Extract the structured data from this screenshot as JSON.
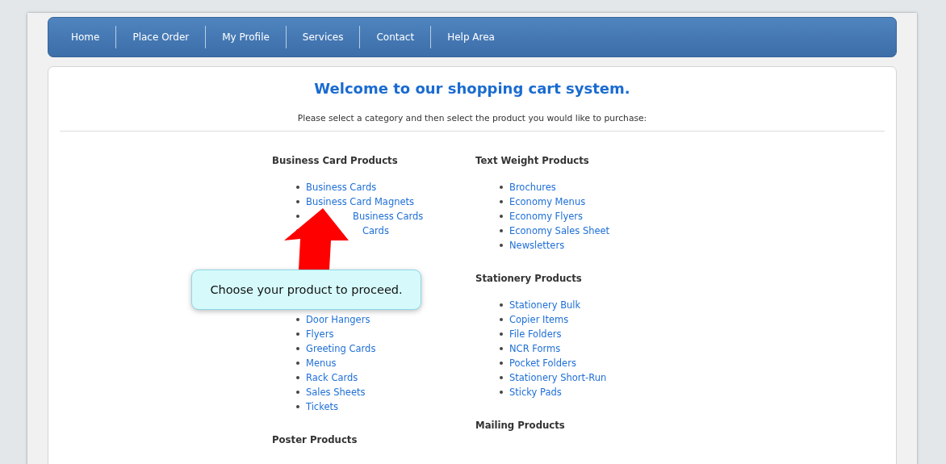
{
  "nav": [
    {
      "label": "Home"
    },
    {
      "label": "Place Order"
    },
    {
      "label": "My Profile"
    },
    {
      "label": "Services"
    },
    {
      "label": "Contact"
    },
    {
      "label": "Help Area"
    }
  ],
  "title": "Welcome to our shopping cart system.",
  "intro": "Please select a category and then select the product you would like to purchase:",
  "columns": [
    {
      "categories": [
        {
          "heading": "Business Card Products",
          "items": [
            {
              "label": "Business Cards"
            },
            {
              "label": "Business Card Magnets"
            },
            {
              "label": "Business Cards"
            },
            {
              "label": "Cards"
            }
          ]
        },
        {
          "items": [
            {
              "label": "Door Hangers"
            },
            {
              "label": "Flyers"
            },
            {
              "label": "Greeting Cards"
            },
            {
              "label": "Menus"
            },
            {
              "label": "Rack Cards"
            },
            {
              "label": "Sales Sheets"
            },
            {
              "label": "Tickets"
            }
          ]
        },
        {
          "heading": "Poster Products"
        }
      ]
    },
    {
      "categories": [
        {
          "heading": "Text Weight Products",
          "items": [
            {
              "label": "Brochures"
            },
            {
              "label": "Economy Menus"
            },
            {
              "label": "Economy Flyers"
            },
            {
              "label": "Economy Sales Sheet"
            },
            {
              "label": "Newsletters"
            }
          ]
        },
        {
          "heading": "Stationery Products",
          "items": [
            {
              "label": "Stationery Bulk"
            },
            {
              "label": "Copier Items"
            },
            {
              "label": "File Folders"
            },
            {
              "label": "NCR Forms"
            },
            {
              "label": "Pocket Folders"
            },
            {
              "label": "Stationery Short-Run"
            },
            {
              "label": "Sticky Pads"
            }
          ]
        },
        {
          "heading": "Mailing Products"
        }
      ]
    }
  ],
  "callout": {
    "text": "Choose your product to proceed."
  }
}
